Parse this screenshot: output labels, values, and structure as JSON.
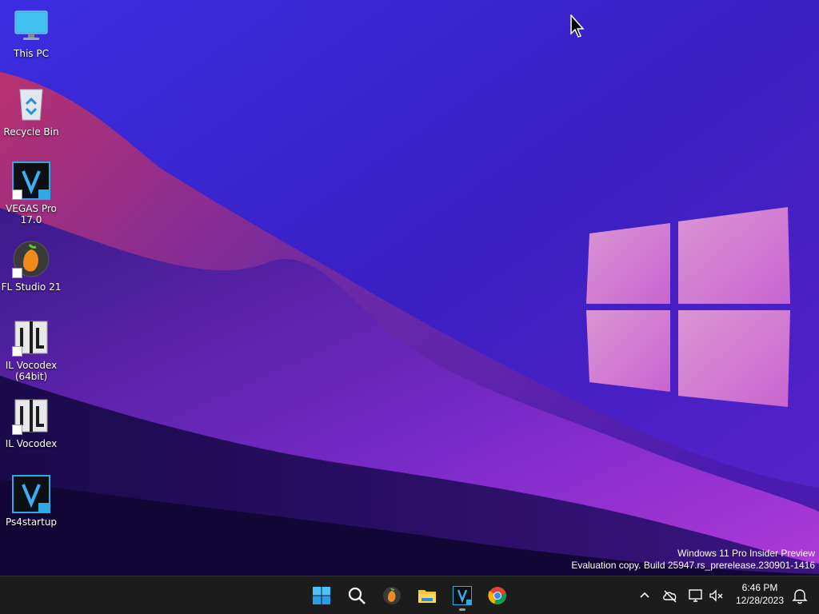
{
  "desktop": {
    "icons": [
      {
        "label": "This PC"
      },
      {
        "label": "Recycle Bin"
      },
      {
        "label": "VEGAS Pro 17.0"
      },
      {
        "label": "FL Studio 21"
      },
      {
        "label": "IL Vocodex (64bit)"
      },
      {
        "label": "IL Vocodex"
      },
      {
        "label": "Ps4startup"
      }
    ],
    "vegas_badge": "17",
    "vocodex_letters": "I L"
  },
  "watermark": {
    "line1": "Windows 11 Pro Insider Preview",
    "line2": "Evaluation copy. Build 25947.rs_prerelease.230901-1416"
  },
  "taskbar": {
    "apps": [
      {
        "name": "start",
        "icon": "windows-logo-icon"
      },
      {
        "name": "search",
        "icon": "search-icon"
      },
      {
        "name": "fl-studio",
        "icon": "fl-studio-icon"
      },
      {
        "name": "file-explorer",
        "icon": "folder-icon"
      },
      {
        "name": "vegas-pro",
        "icon": "vegas-icon",
        "active": true
      },
      {
        "name": "chrome",
        "icon": "chrome-icon"
      }
    ],
    "tray": {
      "chevron": "chevron-up-icon",
      "time": "6:46 PM",
      "date": "12/28/2023"
    }
  },
  "colors": {
    "accent_blue": "#0078d4",
    "taskbar_bg": "#1c1c1c"
  }
}
